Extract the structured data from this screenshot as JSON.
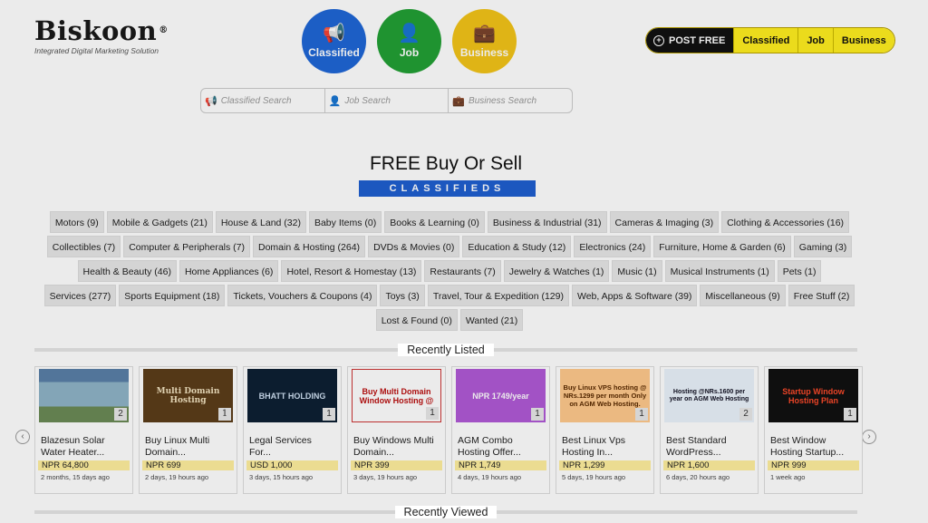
{
  "logo": {
    "name": "Biskoon",
    "reg": "®",
    "tagline": "Integrated Digital Marketing Solution"
  },
  "nav_circles": [
    {
      "label": "Classified",
      "icon": "megaphone-icon",
      "glyph": "📢",
      "color": "#1f66d6"
    },
    {
      "label": "Job",
      "icon": "person-icon",
      "glyph": "👤",
      "color": "#22a035"
    },
    {
      "label": "Business",
      "icon": "briefcase-icon",
      "glyph": "💼",
      "color": "#f2c418"
    }
  ],
  "post_bar": {
    "post_free": "POST FREE",
    "tabs": [
      "Classified",
      "Job",
      "Business"
    ]
  },
  "search": {
    "classified_placeholder": "Classified Search",
    "job_placeholder": "Job Search",
    "business_placeholder": "Business Search"
  },
  "hero": {
    "title": "FREE Buy Or Sell",
    "badge": "CLASSIFIEDS"
  },
  "categories": [
    "Motors (9)",
    "Mobile & Gadgets (21)",
    "House & Land (32)",
    "Baby Items (0)",
    "Books & Learning (0)",
    "Business & Industrial (31)",
    "Cameras & Imaging (3)",
    "Clothing & Accessories (16)",
    "Collectibles (7)",
    "Computer & Peripherals (7)",
    "Domain & Hosting (264)",
    "DVDs & Movies (0)",
    "Education & Study (12)",
    "Electronics (24)",
    "Furniture, Home & Garden (6)",
    "Gaming (3)",
    "Health & Beauty (46)",
    "Home Appliances (6)",
    "Hotel, Resort & Homestay (13)",
    "Restaurants (7)",
    "Jewelry & Watches (1)",
    "Music (1)",
    "Musical Instruments (1)",
    "Pets (1)",
    "Services (277)",
    "Sports Equipment (18)",
    "Tickets, Vouchers & Coupons (4)",
    "Toys (3)",
    "Travel, Tour & Expedition (129)",
    "Web, Apps & Software (39)",
    "Miscellaneous (9)",
    "Free Stuff (2)",
    "Lost & Found (0)",
    "Wanted (21)"
  ],
  "recently_listed": {
    "title": "Recently Listed",
    "items": [
      {
        "title": "Blazesun Solar Water Heater...",
        "price": "NPR 64,800",
        "ago": "2 months, 15 days ago",
        "count": "2",
        "thumb_text": ""
      },
      {
        "title": "Buy Linux Multi Domain...",
        "price": "NPR 699",
        "ago": "2 days, 19 hours ago",
        "count": "1",
        "thumb_text": "Multi Domain Hosting"
      },
      {
        "title": "Legal Services For...",
        "price": "USD 1,000",
        "ago": "3 days, 15 hours ago",
        "count": "1",
        "thumb_text": "BHATT HOLDING"
      },
      {
        "title": "Buy Windows Multi Domain...",
        "price": "NPR 399",
        "ago": "3 days, 19 hours ago",
        "count": "1",
        "thumb_text": "Buy Multi Domain Window Hosting @"
      },
      {
        "title": "AGM Combo Hosting Offer...",
        "price": "NPR 1,749",
        "ago": "4 days, 19 hours ago",
        "count": "1",
        "thumb_text": "NPR 1749/year"
      },
      {
        "title": "Best Linux Vps Hosting In...",
        "price": "NPR 1,299",
        "ago": "5 days, 19 hours ago",
        "count": "1",
        "thumb_text": "Buy Linux VPS hosting @ NRs.1299 per month Only on AGM Web Hosting."
      },
      {
        "title": "Best Standard WordPress...",
        "price": "NPR 1,600",
        "ago": "6 days, 20 hours ago",
        "count": "2",
        "thumb_text": "Hosting @NRs.1600 per year on AGM Web Hosting"
      },
      {
        "title": "Best Window Hosting Startup...",
        "price": "NPR 999",
        "ago": "1 week ago",
        "count": "1",
        "thumb_text": "Startup Window Hosting Plan"
      }
    ]
  },
  "recently_viewed": {
    "title": "Recently Viewed"
  },
  "arrows": {
    "prev": "‹",
    "next": "›"
  }
}
